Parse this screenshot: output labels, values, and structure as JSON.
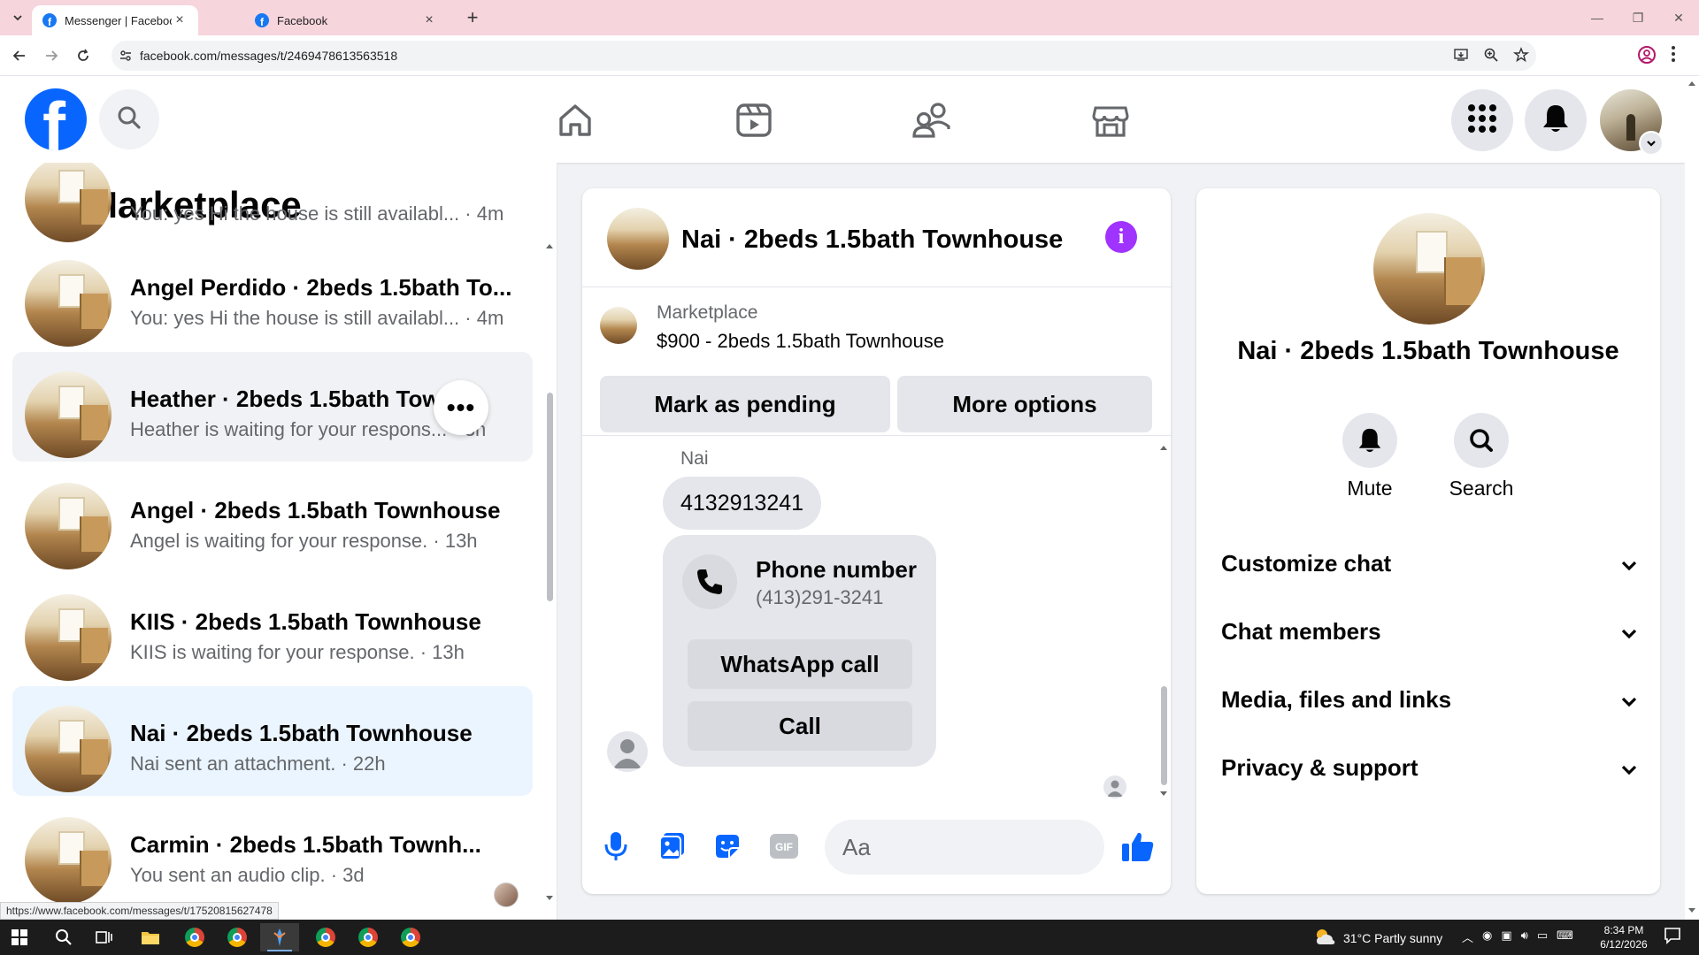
{
  "browser": {
    "tabs": [
      {
        "label": "Messenger | Facebook",
        "active": true
      },
      {
        "label": "Facebook",
        "active": false
      }
    ],
    "url": "facebook.com/messages/t/2469478613563518",
    "status_url": "https://www.facebook.com/messages/t/17520815627478"
  },
  "left_panel": {
    "title": "Marketplace",
    "chats": [
      {
        "name": "",
        "preview": "You: yes Hi the house is still availabl... · 4m",
        "state": "partial"
      },
      {
        "name": "Angel Perdido · 2beds 1.5bath To...",
        "preview": "You: yes Hi the house is still availabl... · 4m",
        "state": "normal"
      },
      {
        "name": "Heather · 2beds 1.5bath Townh...",
        "preview": "Heather is waiting for your respons... · 3h",
        "state": "hover"
      },
      {
        "name": "Angel · 2beds 1.5bath Townhouse",
        "preview": "Angel is waiting for your response. · 13h",
        "state": "normal"
      },
      {
        "name": "KIIS · 2beds 1.5bath Townhouse",
        "preview": "KIIS is waiting for your response. · 13h",
        "state": "normal"
      },
      {
        "name": "Nai · 2beds 1.5bath Townhouse",
        "preview": "Nai sent an attachment. · 22h",
        "state": "selected"
      },
      {
        "name": "Carmin · 2beds 1.5bath Townh...",
        "preview": "You sent an audio clip. · 3d",
        "state": "normal"
      }
    ]
  },
  "conversation": {
    "title": "Nai · 2beds 1.5bath Townhouse",
    "marketplace_label": "Marketplace",
    "listing": "$900 - 2beds 1.5bath Townhouse",
    "mark_pending_label": "Mark as pending",
    "more_options_label": "More options",
    "sender": "Nai",
    "message_text": "4132913241",
    "phone_card": {
      "title": "Phone number",
      "number": "(413)291-3241",
      "whatsapp_label": "WhatsApp call",
      "call_label": "Call"
    },
    "composer_placeholder": "Aa"
  },
  "info_panel": {
    "title": "Nai · 2beds 1.5bath Townhouse",
    "mute_label": "Mute",
    "search_label": "Search",
    "sections": [
      "Customize chat",
      "Chat members",
      "Media, files and links",
      "Privacy & support"
    ]
  },
  "taskbar": {
    "weather": "31°C  Partly sunny",
    "time": "8:34 PM",
    "date": "6/12/2026"
  },
  "colors": {
    "fb_blue": "#0866ff",
    "info_purple": "#a033ff",
    "selected_bg": "#ebf5ff",
    "tabstrip": "#f6d5dd"
  }
}
